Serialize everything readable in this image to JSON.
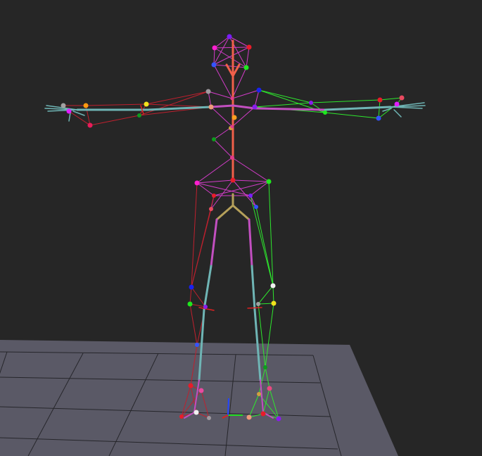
{
  "viewport": {
    "background": "#262626"
  },
  "ground": {
    "fill": "#5a5966",
    "grid_line": "#26262b"
  },
  "skeleton": {
    "bone_colors": {
      "spine": "#f0604a",
      "hip": "#b5a05a",
      "left_limb": "#c24fc0",
      "right_limb": "#6fb5b5",
      "center": "#e04050"
    },
    "link_colors": {
      "center": "#d23cc8",
      "left": "#c0202e",
      "right": "#2ee82e"
    },
    "marker_count": 52
  },
  "axes_gizmo": {
    "x_color": "#22dd22",
    "y_color": "#2244ff",
    "z_color": "#dd2222"
  }
}
